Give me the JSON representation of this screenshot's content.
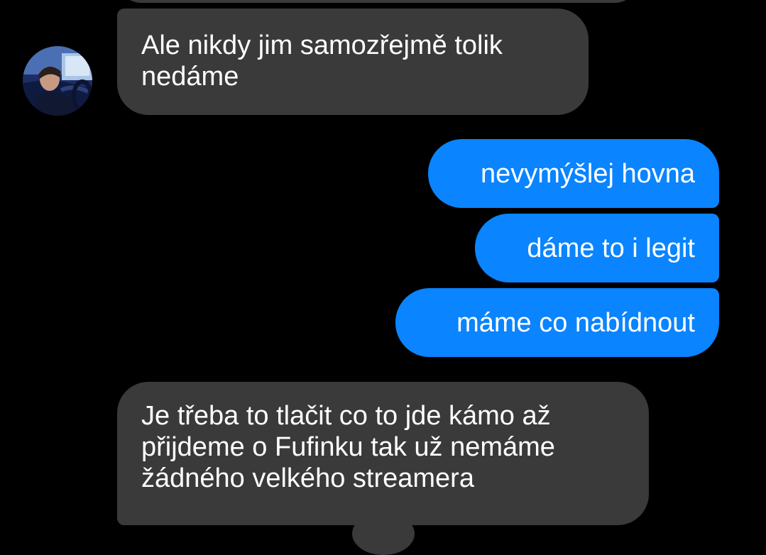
{
  "chat": {
    "messages": [
      {
        "sender": "contact",
        "text": "Ale nikdy jim samozřejmě tolik\nnedáme"
      },
      {
        "sender": "me",
        "text": "nevymýšlej hovna"
      },
      {
        "sender": "me",
        "text": "dáme to i legit"
      },
      {
        "sender": "me",
        "text": "máme co nabídnout"
      },
      {
        "sender": "contact",
        "text": "Je třeba to tlačit co to jde kámo až\npřijdeme o Fufinku tak už nemáme\nžádného velkého streamera"
      }
    ]
  },
  "colors": {
    "background": "#000000",
    "incoming_bubble": "#3a3a3a",
    "outgoing_bubble": "#0a84ff",
    "text": "#ffffff"
  },
  "icons": {
    "contact_avatar": "avatar-photo"
  }
}
